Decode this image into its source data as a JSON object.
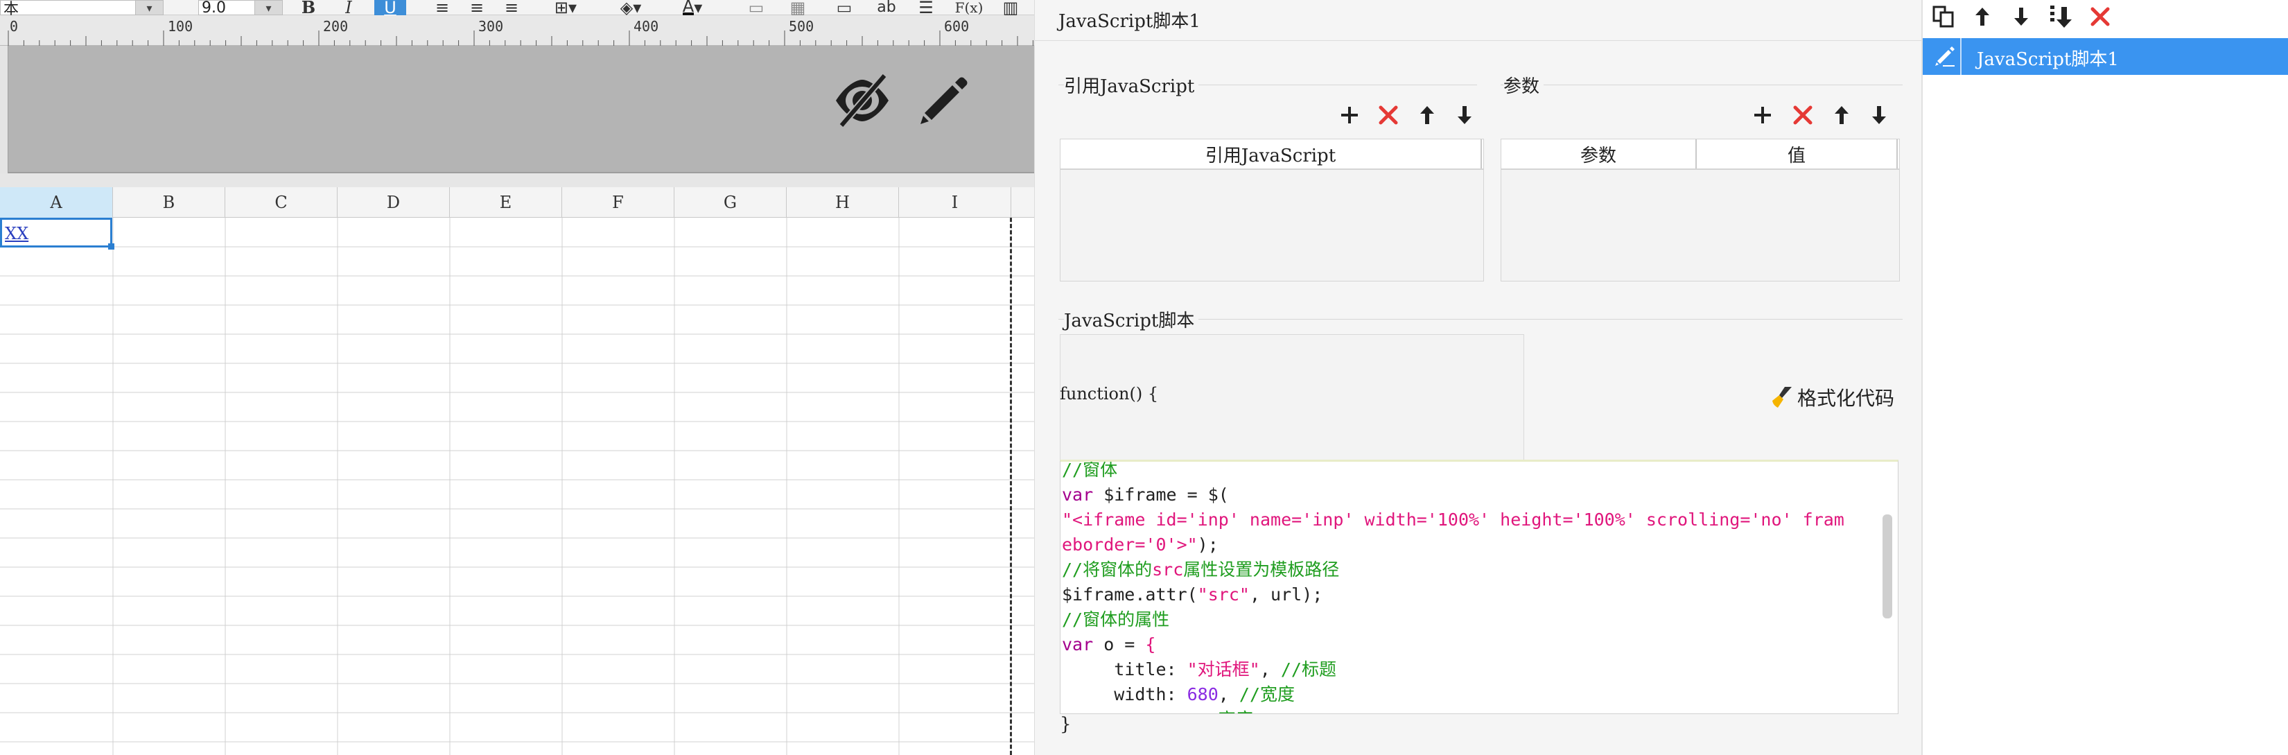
{
  "toolbar": {
    "font_name": "本",
    "font_size": "9.0",
    "bold_label": "B",
    "italic_label": "I",
    "underline_label": "U",
    "wrap_label": "ab",
    "formula_label": "F(x)",
    "icons": [
      "align-left-icon",
      "align-center-icon",
      "align-right-icon",
      "border-icon",
      "fill-color-icon",
      "font-color-icon",
      "merge-icon",
      "split-icon",
      "insert-row-icon",
      "wrap-icon",
      "text-align-icon",
      "formula-icon",
      "columns-icon"
    ]
  },
  "ruler": {
    "labels": [
      "0",
      "100",
      "200",
      "300",
      "400",
      "500",
      "600"
    ]
  },
  "sheet": {
    "columns": [
      "A",
      "B",
      "C",
      "D",
      "E",
      "F",
      "G",
      "H",
      "I"
    ],
    "selected_column": "A",
    "cell_a1": "XX"
  },
  "editor": {
    "title": "JavaScript脚本1",
    "ref_section_label": "引用JavaScript",
    "param_section_label": "参数",
    "ref_table_header": "引用JavaScript",
    "param_table_headers": [
      "参数",
      "值"
    ],
    "script_section_label": "JavaScript脚本",
    "function_open": "function() {",
    "function_close": "}",
    "format_button": "格式化代码",
    "code_lines": [
      [
        {
          "t": "//窗体",
          "c": "c-comment"
        }
      ],
      [
        {
          "t": "var",
          "c": "c-kw"
        },
        {
          "t": " $iframe = $(",
          "c": "c-plain"
        },
        {
          "t": "",
          "c": "c-str"
        }
      ],
      [
        {
          "t": "\"<iframe id='inp' name='inp' width='100%' height='100%' scrolling='no' fram",
          "c": "c-str"
        }
      ],
      [
        {
          "t": "eborder='0'>\"",
          "c": "c-str"
        },
        {
          "t": ");",
          "c": "c-plain"
        }
      ],
      [
        {
          "t": "//将窗体的",
          "c": "c-comment"
        },
        {
          "t": "src",
          "c": "c-str"
        },
        {
          "t": "属性设置为模板路径",
          "c": "c-comment"
        }
      ],
      [
        {
          "t": "$iframe.attr(",
          "c": "c-plain"
        },
        {
          "t": "\"src\"",
          "c": "c-str"
        },
        {
          "t": ", url);",
          "c": "c-plain"
        }
      ],
      [
        {
          "t": "//窗体的属性",
          "c": "c-comment"
        }
      ],
      [
        {
          "t": "var",
          "c": "c-kw"
        },
        {
          "t": " o = ",
          "c": "c-plain"
        },
        {
          "t": "{",
          "c": "c-str"
        }
      ],
      [
        {
          "t": "     title: ",
          "c": "c-plain"
        },
        {
          "t": "\"对话框\"",
          "c": "c-str"
        },
        {
          "t": ", ",
          "c": "c-plain"
        },
        {
          "t": "//标题",
          "c": "c-comment"
        }
      ],
      [
        {
          "t": "     width: ",
          "c": "c-plain"
        },
        {
          "t": "680",
          "c": "c-num"
        },
        {
          "t": ", ",
          "c": "c-plain"
        },
        {
          "t": "//宽度",
          "c": "c-comment"
        }
      ],
      [
        {
          "t": "               高度",
          "c": "c-comment"
        }
      ]
    ]
  },
  "script_list": {
    "items": [
      "JavaScript脚本1"
    ],
    "selected_index": 0
  },
  "colors": {
    "accent": "#3a94f0",
    "delete_red": "#e53935",
    "comment_green": "#1f9d1f",
    "keyword_purple": "#a4008d",
    "string_pink": "#e0167c"
  }
}
